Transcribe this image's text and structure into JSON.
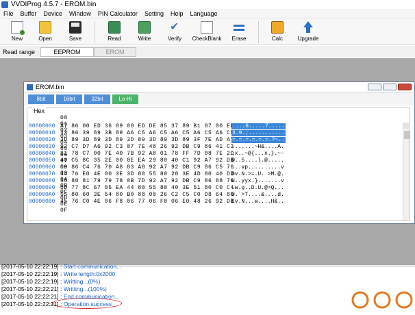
{
  "app": {
    "title": "VVDIProg 4.5.7 - EROM.bin"
  },
  "menu": {
    "items": [
      "File",
      "Buffer",
      "Device",
      "Window",
      "PIN Calculator",
      "Setting",
      "Help",
      "Language"
    ]
  },
  "toolbar": {
    "buttons": [
      {
        "label": "New",
        "icon": "new-file-icon"
      },
      {
        "label": "Open",
        "icon": "folder-icon"
      },
      {
        "label": "Save",
        "icon": "floppy-icon"
      },
      {
        "label": "Read",
        "icon": "chip-read-icon"
      },
      {
        "label": "Write",
        "icon": "chip-write-icon"
      },
      {
        "label": "Verify",
        "icon": "check-icon"
      },
      {
        "label": "CheckBlank",
        "icon": "blank-page-icon"
      },
      {
        "label": "Erase",
        "icon": "erase-icon"
      },
      {
        "label": "Calc",
        "icon": "calculator-icon"
      },
      {
        "label": "Upgrade",
        "icon": "up-arrow-icon"
      }
    ]
  },
  "range": {
    "label": "Read range",
    "tabs": [
      "EEPROM",
      "EROM"
    ],
    "active": "EEPROM"
  },
  "child_window": {
    "title": "EROM.bin",
    "modes": [
      "8bit",
      "16bit",
      "32bit",
      "Lo-Hi"
    ],
    "active_mode": "Lo-Hi",
    "hex": {
      "legend": "Hex",
      "columns": [
        "00",
        "01",
        "02",
        "03",
        "04",
        "05",
        "06",
        "07",
        "08",
        "09",
        "0A",
        "0B",
        "0C",
        "0D",
        "0E",
        "0F"
      ],
      "rows": [
        {
          "addr": "00000000",
          "bytes": "A7 86 00 ED 36 89 00 ED DE 85 37 89 B1 87 00 ED",
          "ascii": "....6.....7.....",
          "selected": true
        },
        {
          "addr": "00000010",
          "bytes": "33 86 39 89 3B 89 A6 C5 A6 C5 A6 C5 A6 C5 A6 C5",
          "ascii": "3.9.;...........",
          "selected": true
        },
        {
          "addr": "00000020",
          "bytes": "3D 89 3D 89 3D 89 3D 89 3D 89 3D 89 3F 7E AD A7",
          "ascii": "=.=.=.=.=.=.?~..",
          "selected": true
        },
        {
          "addr": "00000030",
          "bytes": "92 C7 D7 A6 92 C3 07 7E 48 26 92 DB C9 86 41 C3",
          "ascii": ".......~H&....A.",
          "selected": false
        },
        {
          "addr": "00000040",
          "bytes": "81 78 C7 00 7E 40 7B 92 A8 01 78 FF 7D 08 7E 2D",
          "ascii": ".x..~@{...x.}.~-",
          "selected": false
        },
        {
          "addr": "00000050",
          "bytes": "40 C5 8C 35 2E 00 0E EA 29 80 40 C1 92 A7 92 DB",
          "ascii": "@..5....).@.....",
          "selected": false
        },
        {
          "addr": "00000060",
          "bytes": "C9 86 C4 76 70 A8 83 A8 92 A7 92 DB C9 86 C5 76",
          "ascii": "...vp..........v",
          "selected": false
        },
        {
          "addr": "00000070",
          "bytes": "44 76 E0 4E 00 3E 3D 80 55 80 20 3E 4D 80 40 DD",
          "ascii": "Dv.N.>=.U. >M.@.",
          "selected": false
        },
        {
          "addr": "00000080",
          "bytes": "55 80 81 79 79 78 0B 7D 92 A7 92 DB C9 86 88 76",
          "ascii": "U..yyx.}.......v",
          "selected": false
        },
        {
          "addr": "00000090",
          "bytes": "0D 77 8C 67 05 EA 44 80 55 80 40 3E 51 80 C0 C4",
          "ascii": ".w.g..D.U.@>Q...",
          "selected": false
        },
        {
          "addr": "000000A0",
          "bytes": "55 80 60 3E 54 80 B0 88 00 26 C2 C5 C0 D8 64 80",
          "ascii": "U.`>T....&....d.",
          "selected": false
        },
        {
          "addr": "000000B0",
          "bytes": "45 76 C0 4E 06 F8 06 77 06 F0 06 E0 48 26 92 DB",
          "ascii": "Ev.N...w....H&..",
          "selected": false
        }
      ]
    }
  },
  "log": {
    "lines": [
      {
        "ts": "2017-05-10 22:22:19]",
        "msg": "Start communication..."
      },
      {
        "ts": "2017-05-10 22:22:19]",
        "msg": "Write length:0x2000"
      },
      {
        "ts": "2017-05-10 22:22:19]",
        "msg": "Writting...(0%)"
      },
      {
        "ts": "2017-05-10 22:22:21]",
        "msg": "Writting...(100%)"
      },
      {
        "ts": "2017-05-10 22:22:21]",
        "msg": "End communication..."
      },
      {
        "ts": "2017-05-10 22:22:21]",
        "msg": "Operation success"
      }
    ],
    "separator": " : "
  },
  "colors": {
    "workspace": "#a8a8a8",
    "selection": "#3a86d8",
    "mode_blue": "#4f8fd7",
    "mode_green": "#4cb36b",
    "highlight_ring": "#d22a2a",
    "log_text": "#1e5fc0"
  }
}
